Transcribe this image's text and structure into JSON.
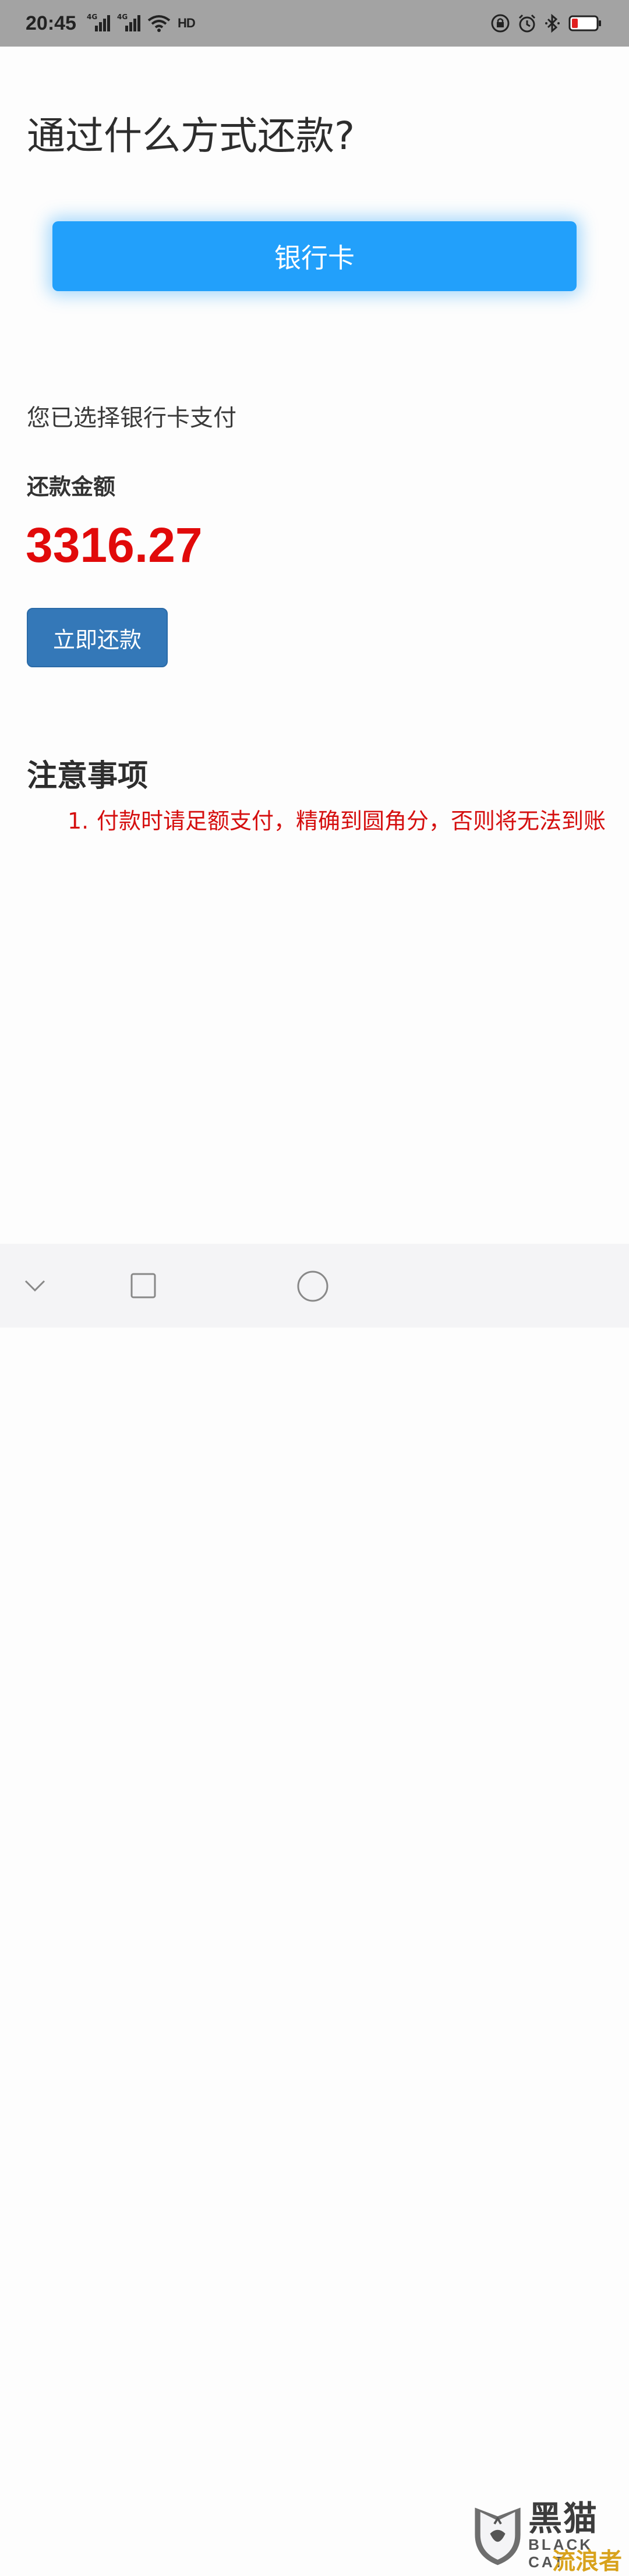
{
  "status_bar": {
    "time": "20:45",
    "signal_tag_1": "4G",
    "signal_tag_2": "4G",
    "hd_label": "HD",
    "icons": [
      "signal-4g-icon",
      "signal-4g-icon",
      "wifi-icon",
      "hd-icon",
      "lock-rotation-icon",
      "alarm-icon",
      "bluetooth-icon",
      "battery-low-icon"
    ],
    "bg_color": "#a3a3a3",
    "battery_color": "#e02020"
  },
  "page": {
    "title": "通过什么方式还款?",
    "payment_method_button": "银行卡",
    "selected_text": "您已选择银行卡支付",
    "amount_label": "还款金额",
    "amount_value": "3316.27",
    "pay_button": "立即还款"
  },
  "notes": {
    "title": "注意事项",
    "items": [
      {
        "num": "1.",
        "text": "付款时请足额支付，精确到圆角分，否则将无法到账"
      }
    ]
  },
  "nav_bar": {
    "icons": [
      "back-icon",
      "recent-apps-icon",
      "home-icon"
    ]
  },
  "watermark": {
    "cn": "黑猫",
    "en": "BLACK CAT",
    "sub": "流浪者"
  },
  "colors": {
    "primary_blue": "#22a0fb",
    "pay_blue": "#3478b8",
    "amount_red": "#e10a0a",
    "note_red": "#d50f0f"
  }
}
